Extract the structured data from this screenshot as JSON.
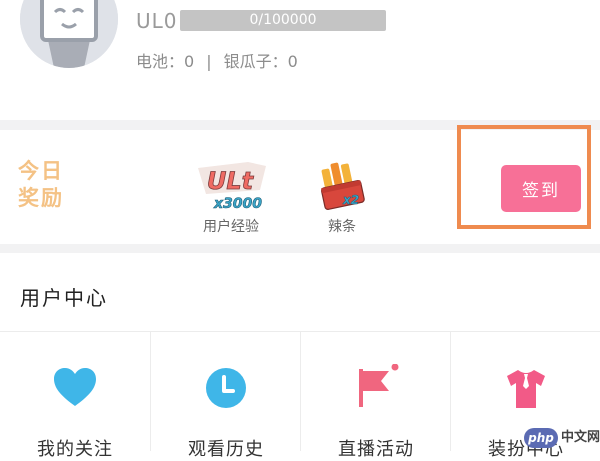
{
  "profile": {
    "level": "UL0",
    "exp_text": "0/100000",
    "exp_fraction": 0,
    "battery_label": "电池：",
    "battery_value": "0",
    "separator": "|",
    "melon_label": "银瓜子：",
    "melon_value": "0"
  },
  "reward": {
    "title": "今日奖励",
    "items": [
      {
        "label": "用户经验",
        "icon": "ul-exp-badge-icon",
        "badge_text": "ULt",
        "multiplier": "x3000"
      },
      {
        "label": "辣条",
        "icon": "spicy-strip-icon",
        "multiplier": "x2"
      }
    ],
    "checkin_label": "签到"
  },
  "user_center": {
    "title": "用户中心",
    "items": [
      {
        "label": "我的关注",
        "icon": "heart-icon",
        "color": "#3fb6e8"
      },
      {
        "label": "观看历史",
        "icon": "clock-icon",
        "color": "#3fb6e8"
      },
      {
        "label": "直播活动",
        "icon": "flag-icon",
        "color": "#f0667f"
      },
      {
        "label": "装扮中心",
        "icon": "shirt-icon",
        "color": "#f25a87"
      }
    ]
  },
  "colors": {
    "accent_pink": "#f77097",
    "reward_title": "#f4c285",
    "highlight_frame": "#ef8b4f"
  },
  "watermark": {
    "badge": "php",
    "text": "中文网"
  }
}
